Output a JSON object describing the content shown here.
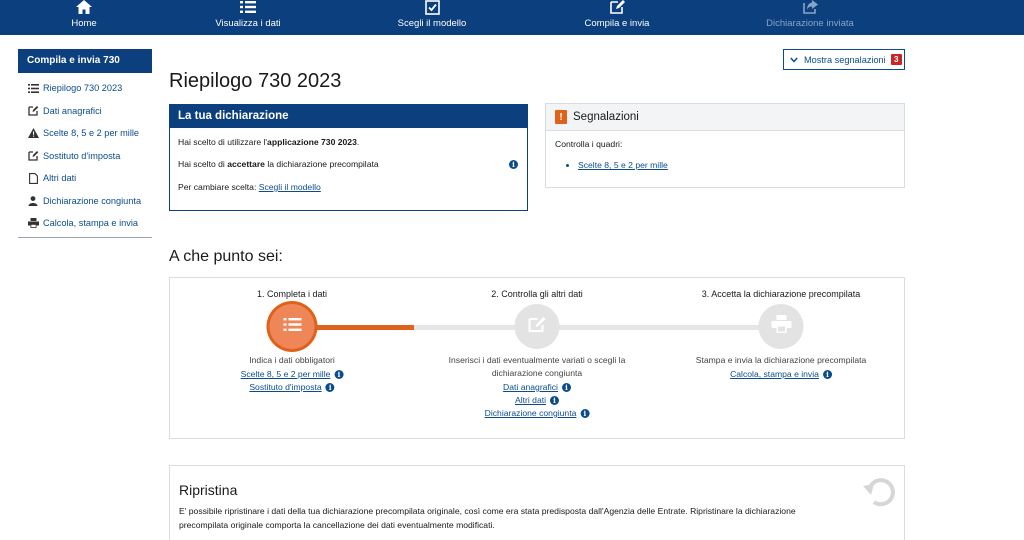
{
  "nav": {
    "items": [
      {
        "label": "Home",
        "icon": "home-icon"
      },
      {
        "label": "Visualizza i dati",
        "icon": "list-icon"
      },
      {
        "label": "Scegli il modello",
        "icon": "checkbox-icon"
      },
      {
        "label": "Compila e invia",
        "icon": "edit-icon"
      },
      {
        "label": "Dichiarazione inviata",
        "icon": "share-icon"
      }
    ]
  },
  "sidebar": {
    "header": "Compila e invia 730",
    "items": [
      {
        "label": "Riepilogo 730 2023",
        "icon": "list-icon"
      },
      {
        "label": "Dati anagrafici",
        "icon": "edit-icon"
      },
      {
        "label": "Scelte 8, 5 e 2 per mille",
        "icon": "warning-icon"
      },
      {
        "label": "Sostituto d'imposta",
        "icon": "edit-icon"
      },
      {
        "label": "Altri dati",
        "icon": "document-icon"
      },
      {
        "label": "Dichiarazione congiunta",
        "icon": "user-icon"
      },
      {
        "label": "Calcola, stampa e invia",
        "icon": "print-icon"
      }
    ]
  },
  "main": {
    "title": "Riepilogo 730 2023",
    "segnalazioni_button": {
      "label": "Mostra segnalazioni",
      "count": "3"
    },
    "dichiarazione": {
      "title": "La tua dichiarazione",
      "row1_pre": "Hai scelto di utilizzare l'",
      "row1_bold": "applicazione 730 2023",
      "row1_post": ".",
      "row2_pre": "Hai scelto di ",
      "row2_bold": "accettare",
      "row2_post": " la dichiarazione precompilata",
      "row3_pre": "Per cambiare scelta: ",
      "row3_link": "Scegli il modello"
    },
    "segnalazioni": {
      "title": "Segnalazioni",
      "intro": "Controlla i quadri:",
      "items": [
        "Scelte 8, 5 e 2 per mille"
      ]
    },
    "progress_title": "A che punto sei:",
    "steps": [
      {
        "title": "1. Completa i dati",
        "desc": "Indica i dati obbligatori",
        "links": [
          "Scelte 8, 5 e 2 per mille",
          "Sostituto d'imposta"
        ],
        "icon": "list-icon"
      },
      {
        "title": "2. Controlla gli altri dati",
        "desc_line1": "Inserisci i dati eventualmente variati o scegli la",
        "desc_line2": "dichiarazione congiunta",
        "links": [
          "Dati anagrafici",
          "Altri dati",
          "Dichiarazione congiunta"
        ],
        "icon": "edit-icon"
      },
      {
        "title": "3. Accetta la dichiarazione precompilata",
        "desc": "Stampa e invia la dichiarazione precompilata",
        "links": [
          "Calcola, stampa e invia"
        ],
        "icon": "print-icon"
      }
    ],
    "ripristina": {
      "title": "Ripristina",
      "text": "E' possibile ripristinare i dati della tua dichiarazione precompilata originale, così come era stata predisposta dall'Agenzia delle Entrate. Ripristinare la dichiarazione precompilata originale comporta la cancellazione dei dati eventualmente modificati."
    },
    "colors": {
      "primary": "#0b3f7d",
      "accent": "#e0611a",
      "alert": "#c62828"
    }
  }
}
